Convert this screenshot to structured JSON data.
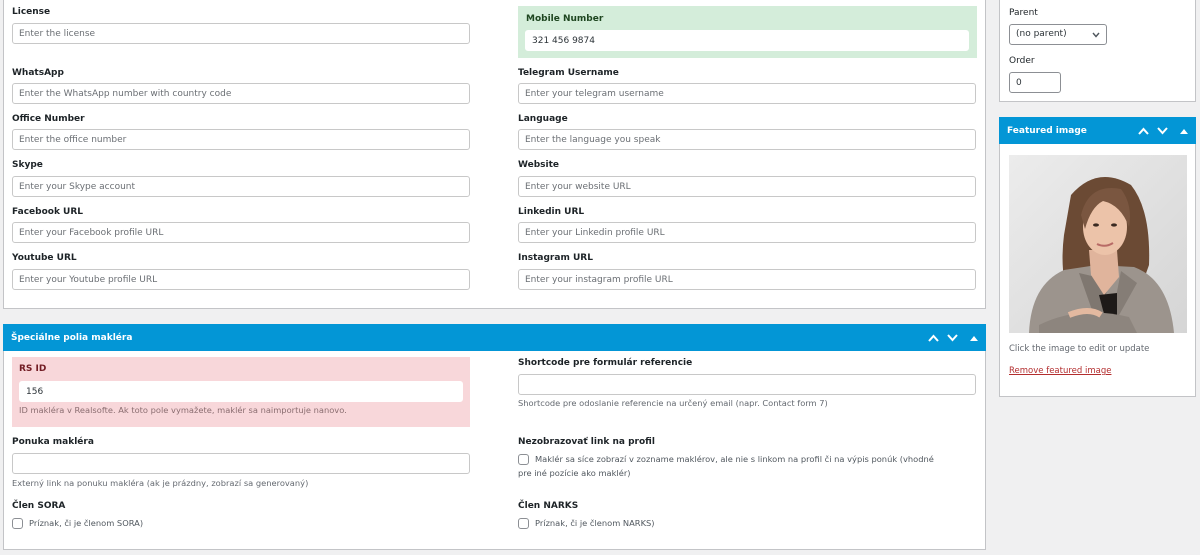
{
  "contact_section": {
    "left_fields": [
      {
        "label": "License",
        "placeholder": "Enter the license",
        "value": ""
      },
      {
        "label": "WhatsApp",
        "placeholder": "Enter the WhatsApp number with country code",
        "value": ""
      },
      {
        "label": "Office Number",
        "placeholder": "Enter the office number",
        "value": ""
      },
      {
        "label": "Skype",
        "placeholder": "Enter your Skype account",
        "value": ""
      },
      {
        "label": "Facebook URL",
        "placeholder": "Enter your Facebook profile URL",
        "value": ""
      },
      {
        "label": "Youtube URL",
        "placeholder": "Enter your Youtube profile URL",
        "value": ""
      }
    ],
    "right_fields": [
      {
        "label": "Mobile Number",
        "placeholder": "",
        "value": "321 456 9874"
      },
      {
        "label": "Telegram Username",
        "placeholder": "Enter your telegram username",
        "value": ""
      },
      {
        "label": "Language",
        "placeholder": "Enter the language you speak",
        "value": ""
      },
      {
        "label": "Website",
        "placeholder": "Enter your website URL",
        "value": ""
      },
      {
        "label": "Linkedin URL",
        "placeholder": "Enter your Linkedin profile URL",
        "value": ""
      },
      {
        "label": "Instagram URL",
        "placeholder": "Enter your instagram profile URL",
        "value": ""
      }
    ]
  },
  "special_section": {
    "title": "Špeciálne polia makléra",
    "rs_id": {
      "label": "RS ID",
      "value": "156",
      "help": "ID makléra v Realsofte. Ak toto pole vymažete, maklér sa naimportuje nanovo."
    },
    "shortcode": {
      "label": "Shortcode pre formulár referencie",
      "value": "",
      "help": "Shortcode pre odoslanie referencie na určený email (napr. Contact form 7)"
    },
    "ponuka": {
      "label": "Ponuka makléra",
      "value": "",
      "help": "Externý link na ponuku makléra (ak je prázdny, zobrazí sa generovaný)"
    },
    "nezobrazovat": {
      "label": "Nezobrazovať link na profil",
      "checkbox_text": "Maklér sa síce zobrazí v zozname maklérov, ale nie s linkom na profil či na výpis ponúk (vhodné pre iné pozície ako maklér)",
      "checked": false
    },
    "sora": {
      "label": "Člen SORA",
      "checkbox_text": "Príznak, či je členom SORA)",
      "checked": false
    },
    "narks": {
      "label": "Člen NARKS",
      "checkbox_text": "Príznak, či je členom NARKS)",
      "checked": false
    }
  },
  "page_attributes": {
    "parent_label": "Parent",
    "parent_value": "(no parent)",
    "order_label": "Order",
    "order_value": "0"
  },
  "featured_image": {
    "title": "Featured image",
    "hint": "Click the image to edit or update",
    "remove_link": "Remove featured image"
  },
  "colors": {
    "header_blue": "#0396d6",
    "success_bg": "#d4edda",
    "error_bg": "#f8d7da",
    "remove_link": "#b32d2e"
  }
}
